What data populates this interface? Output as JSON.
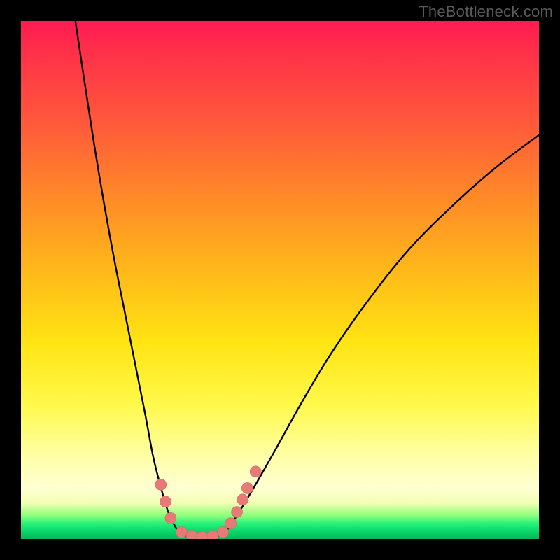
{
  "watermark": {
    "text": "TheBottleneck.com"
  },
  "colors": {
    "curve": "#000000",
    "dots": "#e77a77",
    "dot_stroke": "#d86560",
    "frame_bg": "#000000"
  },
  "chart_data": {
    "type": "line",
    "title": "",
    "xlabel": "",
    "ylabel": "",
    "xlim": [
      0,
      100
    ],
    "ylim": [
      0,
      100
    ],
    "grid": false,
    "legend": false,
    "series": [
      {
        "name": "left-branch",
        "x": [
          10.5,
          12,
          14,
          16,
          18,
          20,
          22,
          24,
          25.5,
          27,
          28.5,
          30
        ],
        "values": [
          100,
          90,
          77,
          65,
          54,
          44,
          34,
          24,
          16,
          10,
          5,
          2
        ]
      },
      {
        "name": "right-branch",
        "x": [
          40,
          42,
          45,
          49,
          54,
          60,
          67,
          75,
          84,
          92,
          100
        ],
        "values": [
          2,
          5,
          10,
          17,
          26,
          36,
          46,
          56,
          65,
          72,
          78
        ]
      },
      {
        "name": "valley-floor",
        "x": [
          30,
          32,
          34,
          36,
          38,
          40
        ],
        "values": [
          2,
          0.6,
          0.2,
          0.2,
          0.6,
          2
        ]
      }
    ],
    "markers": {
      "name": "highlight-dots",
      "points": [
        {
          "x": 27.0,
          "y": 10.5
        },
        {
          "x": 27.9,
          "y": 7.2
        },
        {
          "x": 28.9,
          "y": 4.0
        },
        {
          "x": 31.0,
          "y": 1.3
        },
        {
          "x": 33.0,
          "y": 0.6
        },
        {
          "x": 35.0,
          "y": 0.4
        },
        {
          "x": 37.0,
          "y": 0.6
        },
        {
          "x": 39.0,
          "y": 1.3
        },
        {
          "x": 40.5,
          "y": 3.0
        },
        {
          "x": 41.7,
          "y": 5.2
        },
        {
          "x": 42.8,
          "y": 7.6
        },
        {
          "x": 43.7,
          "y": 9.8
        },
        {
          "x": 45.3,
          "y": 13.0
        }
      ],
      "radius_px": 8
    }
  }
}
